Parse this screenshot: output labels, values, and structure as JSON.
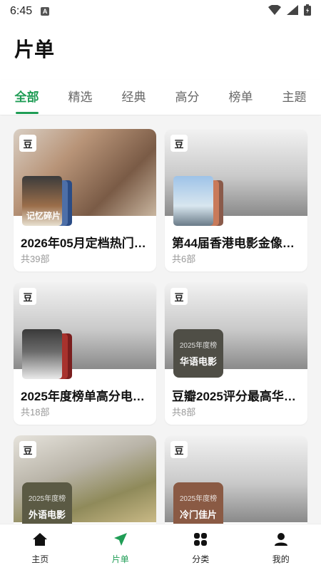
{
  "status_bar": {
    "time": "6:45",
    "notification_icon": "A"
  },
  "page_title": "片单",
  "tabs": [
    {
      "label": "全部",
      "active": true
    },
    {
      "label": "精选",
      "active": false
    },
    {
      "label": "经典",
      "active": false
    },
    {
      "label": "高分",
      "active": false
    },
    {
      "label": "榜单",
      "active": false
    },
    {
      "label": "主题",
      "active": false
    }
  ],
  "badge": "豆",
  "lists": [
    {
      "title": "2026年05月定档热门…",
      "count": "共39部"
    },
    {
      "title": "第44届香港电影金像…",
      "count": "共6部"
    },
    {
      "title": "2025年度榜单高分电…",
      "count": "共18部"
    },
    {
      "title": "豆瓣2025评分最高华…",
      "count": "共8部"
    },
    {
      "title": "",
      "count": ""
    },
    {
      "title": "",
      "count": ""
    }
  ],
  "tiles": {
    "card4": {
      "sub": "2025年度榜",
      "main": "华语电影"
    },
    "card5": {
      "sub": "2025年度榜",
      "main": "外语电影"
    },
    "card6": {
      "sub": "2025年度榜",
      "main": "冷门佳片"
    }
  },
  "poster_text": {
    "card1": "记忆碎片"
  },
  "bottom_nav": [
    {
      "label": "主页",
      "icon": "home-icon"
    },
    {
      "label": "片单",
      "icon": "send-icon",
      "active": true
    },
    {
      "label": "分类",
      "icon": "grid-icon"
    },
    {
      "label": "我的",
      "icon": "user-icon"
    }
  ],
  "colors": {
    "accent": "#1f9d55"
  }
}
